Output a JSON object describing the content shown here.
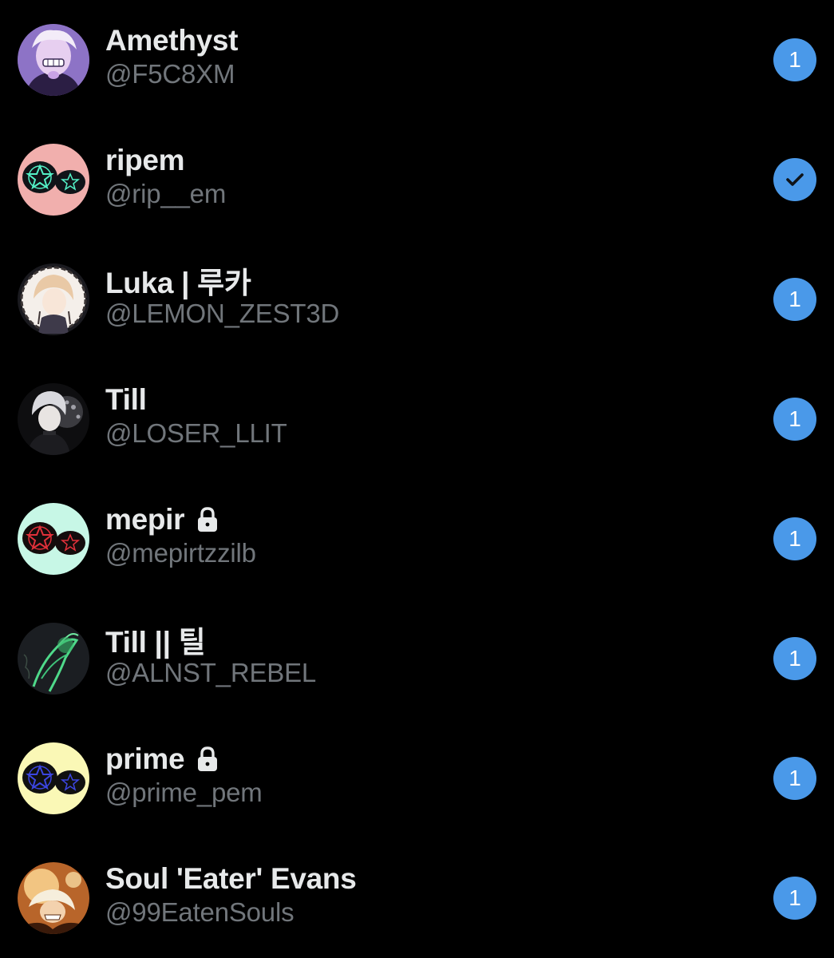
{
  "accounts": [
    {
      "display_name": "Amethyst",
      "handle": "@F5C8XM",
      "locked": false,
      "badge": "1",
      "selected": false,
      "avatar": "amethyst-avatar"
    },
    {
      "display_name": "ripem",
      "handle": "@rip__em",
      "locked": false,
      "badge": "",
      "selected": true,
      "avatar": "pentagram-pink-avatar"
    },
    {
      "display_name": "Luka | 루카",
      "handle": "@LEMON_ZEST3D",
      "locked": false,
      "badge": "1",
      "selected": false,
      "avatar": "anime-blonde-avatar"
    },
    {
      "display_name": "Till",
      "handle": "@LOSER_LLIT",
      "locked": false,
      "badge": "1",
      "selected": false,
      "avatar": "anime-grey-hair-avatar"
    },
    {
      "display_name": "mepir",
      "handle": "@mepirtzzilb",
      "locked": true,
      "badge": "1",
      "selected": false,
      "avatar": "pentagram-mint-avatar"
    },
    {
      "display_name": "Till || 틸",
      "handle": "@ALNST_REBEL",
      "locked": false,
      "badge": "1",
      "selected": false,
      "avatar": "green-sketch-avatar"
    },
    {
      "display_name": "prime",
      "handle": "@prime_pem",
      "locked": true,
      "badge": "1",
      "selected": false,
      "avatar": "pentagram-yellow-avatar"
    },
    {
      "display_name": "Soul 'Eater' Evans",
      "handle": "@99EatenSouls",
      "locked": false,
      "badge": "1",
      "selected": false,
      "avatar": "soul-eater-avatar"
    }
  ],
  "colors": {
    "background": "#000000",
    "name": "#E7E9EA",
    "handle": "#71767B",
    "badge": "#4A99E9"
  }
}
